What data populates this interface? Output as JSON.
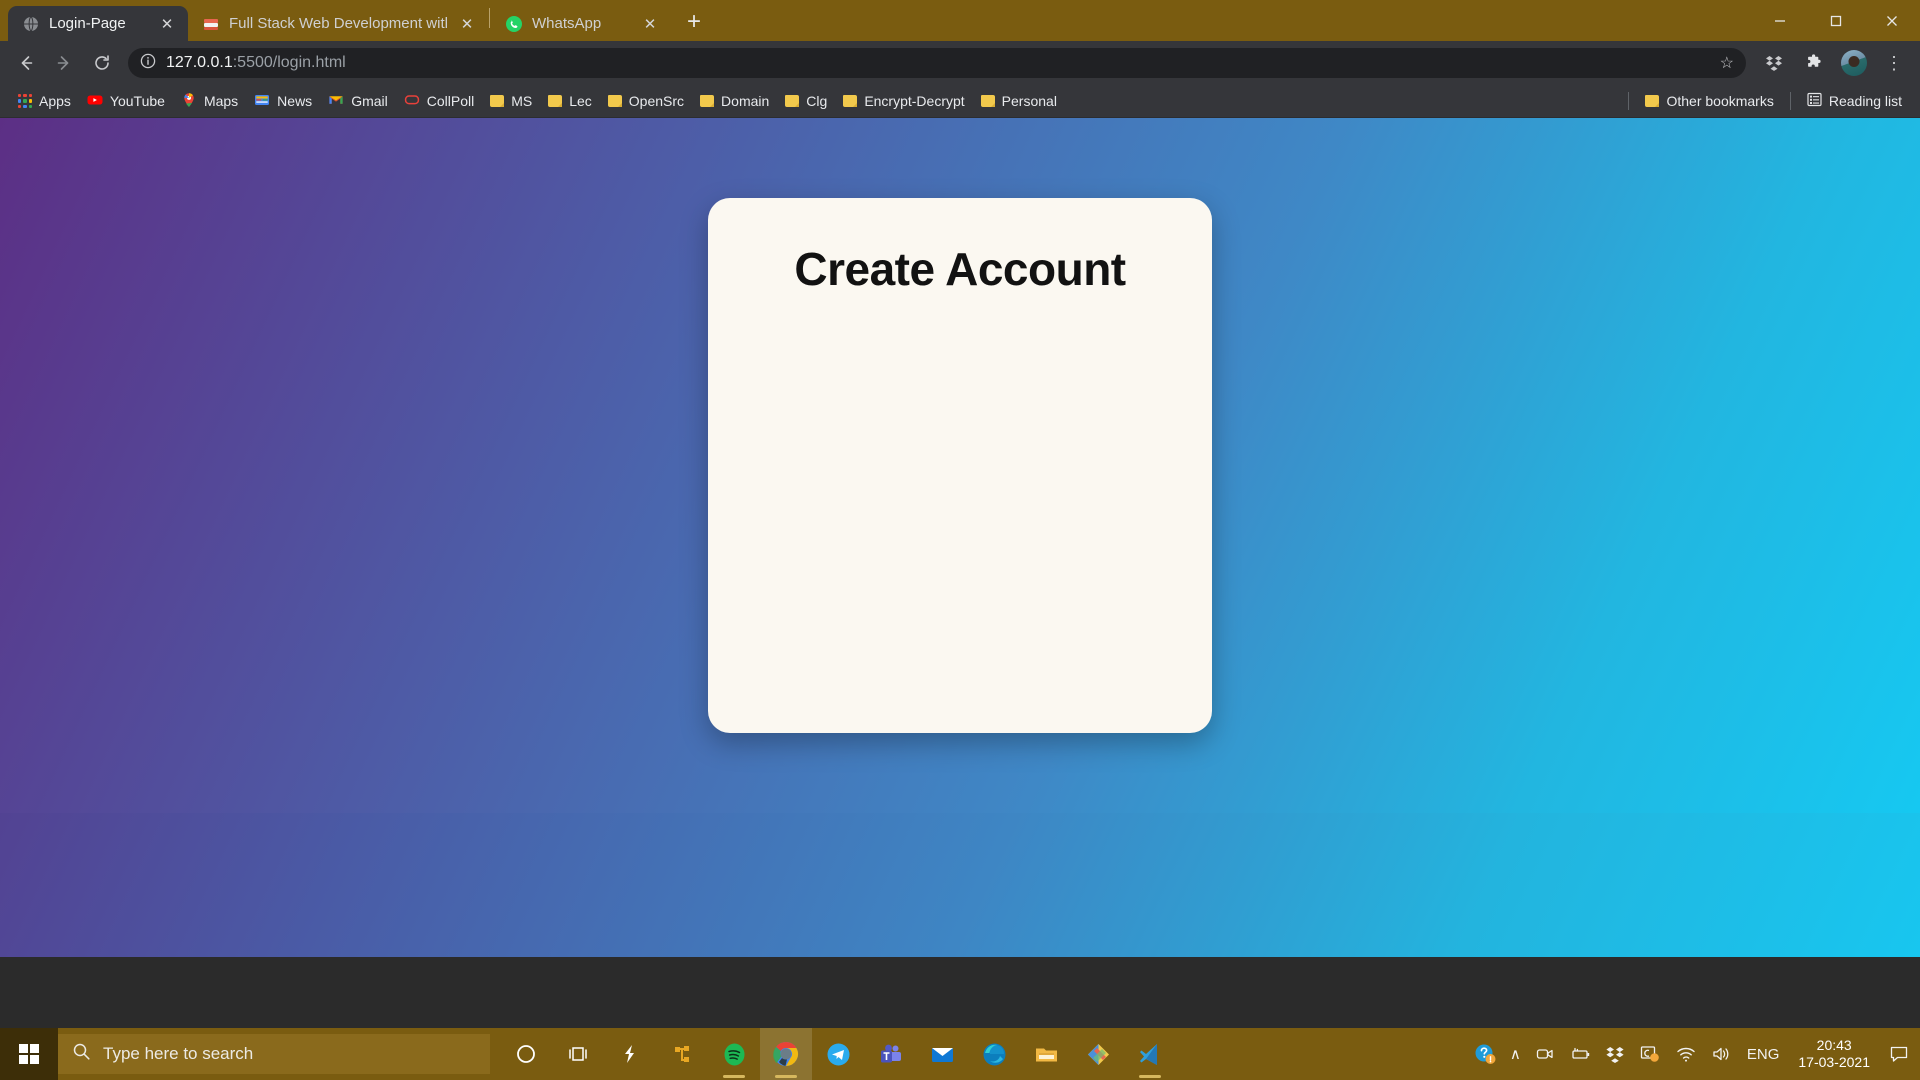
{
  "browser": {
    "tabs": [
      {
        "title": "Login-Page",
        "favicon": "globe-icon",
        "active": true,
        "close": "✕"
      },
      {
        "title": "Full Stack Web Development with",
        "favicon": "books-icon",
        "active": false,
        "close": "✕"
      },
      {
        "title": "WhatsApp",
        "favicon": "whatsapp-icon",
        "active": false,
        "close": "✕"
      }
    ],
    "new_tab_label": "+",
    "window_controls": {
      "minimize": "─",
      "maximize": "☐",
      "close": "✕"
    },
    "nav": {
      "back": "←",
      "forward": "→",
      "reload": "⟳"
    },
    "omnibox": {
      "site_info_icon": "info-circle-icon",
      "url_host": "127.0.0.1",
      "url_path": ":5500/login.html",
      "star_icon": "☆"
    },
    "toolbar_right": [
      "dropbox-icon",
      "extensions-puzzle-icon",
      "profile-avatar",
      "three-dot-menu-icon"
    ],
    "menu_glyph": "⋮",
    "bookmarks": {
      "apps_label": "Apps",
      "items": [
        {
          "label": "YouTube",
          "icon": "youtube-icon"
        },
        {
          "label": "Maps",
          "icon": "maps-icon"
        },
        {
          "label": "News",
          "icon": "news-icon"
        },
        {
          "label": "Gmail",
          "icon": "gmail-icon"
        },
        {
          "label": "CollPoll",
          "icon": "collpoll-icon"
        },
        {
          "label": "MS",
          "icon": "folder-icon"
        },
        {
          "label": "Lec",
          "icon": "folder-icon"
        },
        {
          "label": "OpenSrc",
          "icon": "folder-icon"
        },
        {
          "label": "Domain",
          "icon": "folder-icon"
        },
        {
          "label": "Clg",
          "icon": "folder-icon"
        },
        {
          "label": "Encrypt-Decrypt",
          "icon": "folder-icon"
        },
        {
          "label": "Personal",
          "icon": "folder-icon"
        }
      ],
      "other_bookmarks": "Other bookmarks",
      "reading_list": "Reading list"
    }
  },
  "page": {
    "card_title": "Create Account",
    "background_colors": {
      "start": "#5c2f85",
      "mid": "#3f88c6",
      "end": "#16c8f1"
    },
    "card_color": "#fbf8f1"
  },
  "taskbar": {
    "start_label": "start-button",
    "search_placeholder": "Type here to search",
    "search_icon": "search-icon",
    "apps": [
      {
        "name": "cortana-icon"
      },
      {
        "name": "task-view-icon"
      },
      {
        "name": "lightning-icon"
      },
      {
        "name": "branch-icon"
      },
      {
        "name": "spotify-icon",
        "running": true
      },
      {
        "name": "chrome-icon",
        "running": true,
        "active": true
      },
      {
        "name": "telegram-icon"
      },
      {
        "name": "teams-icon"
      },
      {
        "name": "mail-icon"
      },
      {
        "name": "edge-icon"
      },
      {
        "name": "file-explorer-icon"
      },
      {
        "name": "diamond-app-icon"
      },
      {
        "name": "vscode-icon",
        "running": true
      }
    ],
    "tray": {
      "help_icon": "help-circle-icon",
      "chevron_icon": "∧",
      "camera_icon": "camera-icon",
      "battery_icon": "battery-icon",
      "dropbox_icon": "dropbox-icon",
      "screenshot_icon": "screen-snip-icon",
      "wifi_icon": "wifi-icon",
      "volume_icon": "volume-icon",
      "language": "ENG",
      "time": "20:43",
      "date": "17-03-2021",
      "notification_icon": "notification-icon"
    }
  }
}
